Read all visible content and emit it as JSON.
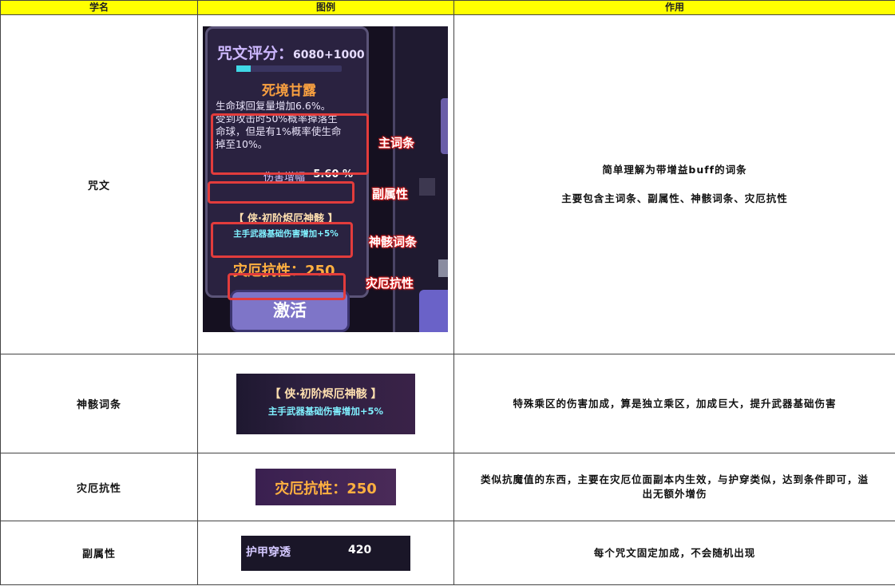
{
  "headers": [
    "学名",
    "图例",
    "作用"
  ],
  "rows": [
    {
      "name": "咒文",
      "desc_lines": [
        "简单理解为带增益buff的词条",
        "主要包含主词条、副属性、神骸词条、灾厄抗性"
      ]
    },
    {
      "name": "神骸词条",
      "desc_lines": [
        "特殊乘区的伤害加成，算是独立乘区，加成巨大，提升武器基础伤害"
      ]
    },
    {
      "name": "灾厄抗性",
      "desc_lines": [
        "类似抗魔值的东西，主要在灾厄位面副本内生效，与护穿类似，达到条件即可，溢",
        "出无额外增伤"
      ]
    },
    {
      "name": "副属性",
      "desc_lines": [
        "每个咒文固定加成，不会随机出现"
      ]
    }
  ],
  "card": {
    "score_label": "咒文评分：",
    "score_value": "6080+1000",
    "score_progress": 0.14,
    "curse_name": "死境甘露",
    "main_lines": [
      "生命球回复量增加6.6%。",
      "受到攻击时50%概率掉落生",
      "命球，但是有1%概率使生命",
      "掉至10%。"
    ],
    "sub_attr_name": "伤害增幅",
    "sub_attr_value": "5.60 %",
    "relic_title": "【 侠·初阶烬厄神骸 】",
    "relic_effect": "主手武器基础伤害增加+5%",
    "resistance": "灾厄抗性：250",
    "activate": "激活",
    "annotations": {
      "main": "主词条",
      "sub": "副属性",
      "relic": "神骸词条",
      "resist": "灾厄抗性"
    }
  },
  "relic_image": {
    "title": "【 侠·初阶烬厄神骸 】",
    "effect": "主手武器基础伤害增加+5%"
  },
  "resist_image": {
    "text": "灾厄抗性：250"
  },
  "subattr_image": {
    "name": "护甲穿透",
    "value": "420"
  },
  "colors": {
    "header_bg": "#ffff00",
    "annotation_red": "#e23c3c",
    "score_bar": "#40d8e6",
    "resist_orange": "#ffb040"
  }
}
